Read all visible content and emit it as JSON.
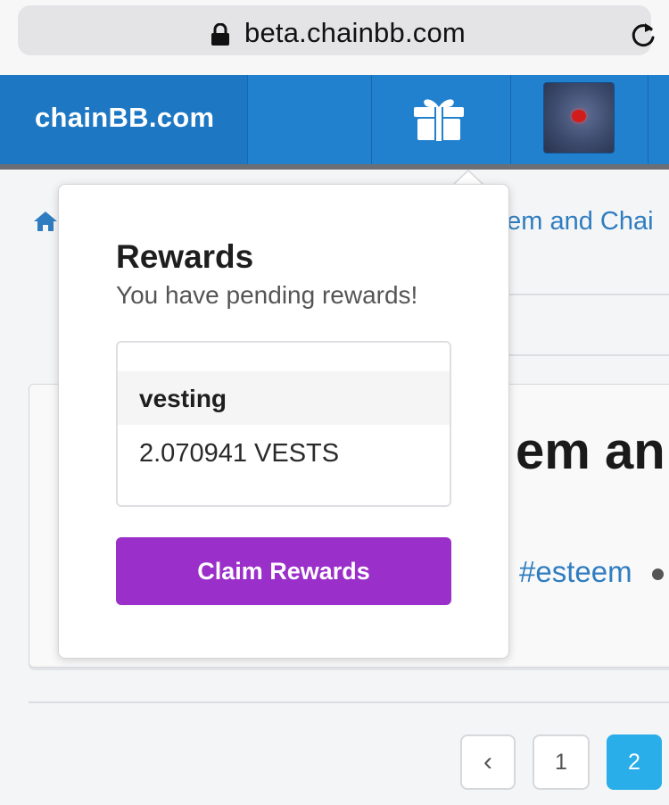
{
  "browser": {
    "url": "beta.chainbb.com"
  },
  "navbar": {
    "brand": "chainBB.com",
    "gift_icon": "gift-icon",
    "accent": "#2181cf"
  },
  "content": {
    "breadcrumb_title": "eem and Chai",
    "post_title": "em an",
    "post_tag": "#esteem"
  },
  "pagination": {
    "prev": "‹",
    "pages": [
      "1",
      "2"
    ],
    "active": "2",
    "active_color": "#29aee9"
  },
  "rewards_popover": {
    "title": "Rewards",
    "subtitle": "You have pending rewards!",
    "items": [
      {
        "type": "vesting",
        "amount": "2.070941 VESTS"
      }
    ],
    "claim_label": "Claim Rewards",
    "claim_color": "#9b2fc9"
  }
}
